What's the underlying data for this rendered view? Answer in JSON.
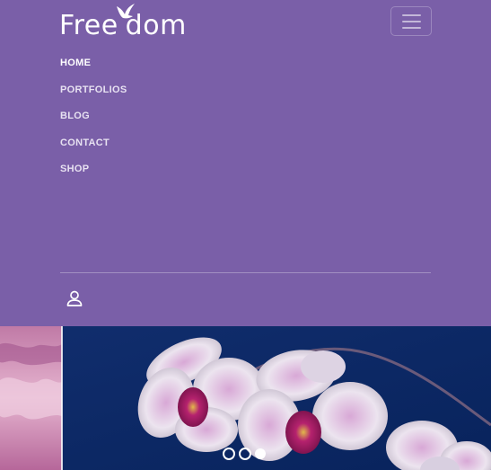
{
  "brand": {
    "name_part1": "Free",
    "name_part2": "dom"
  },
  "nav": {
    "items": [
      {
        "label": "HOME",
        "active": true
      },
      {
        "label": "PORTFOLIOS",
        "active": false
      },
      {
        "label": "BLOG",
        "active": false
      },
      {
        "label": "CONTACT",
        "active": false
      },
      {
        "label": "SHOP",
        "active": false
      }
    ]
  },
  "icons": {
    "menu": "hamburger-icon",
    "user": "user-icon",
    "logo_mark": "bird-icon"
  },
  "slider": {
    "slide_count": 3,
    "active_index": 2
  },
  "colors": {
    "header_bg": "#7a5fa8",
    "text": "#ffffff",
    "sky": "#0e2c6a"
  }
}
